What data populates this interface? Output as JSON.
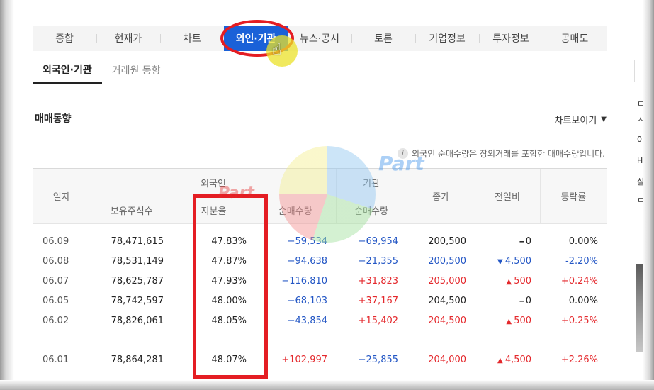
{
  "tabs": [
    "종합",
    "현재가",
    "차트",
    "외인·기관",
    "뉴스·공시",
    "토론",
    "기업정보",
    "투자정보",
    "공매도"
  ],
  "active_tab_index": 3,
  "subtabs": [
    "외국인·기관",
    "거래원 동향"
  ],
  "section_title": "매매동향",
  "chart_toggle": "차트보이기",
  "notice": "외국인 순매수량은 장외거래를 포함한 매매수량입니다.",
  "watermark_text": "Part",
  "headers": {
    "date": "일자",
    "foreign": "외국인",
    "institution": "기관",
    "holdings": "보유주식수",
    "ratio": "지분율",
    "foreign_net": "순매수량",
    "inst_net": "순매수량",
    "close": "종가",
    "change": "전일비",
    "rate": "등락률"
  },
  "rows": [
    {
      "date": "06.09",
      "holdings": "78,471,615",
      "ratio": "47.83%",
      "foreign_net": "−59,534",
      "inst_net": "−69,954",
      "close": "200,500",
      "change": "0",
      "change_dir": "flat",
      "rate": "0.00%"
    },
    {
      "date": "06.08",
      "holdings": "78,531,149",
      "ratio": "47.87%",
      "foreign_net": "−94,638",
      "inst_net": "−21,355",
      "close": "200,500",
      "change": "4,500",
      "change_dir": "down",
      "rate": "-2.20%"
    },
    {
      "date": "06.07",
      "holdings": "78,625,787",
      "ratio": "47.93%",
      "foreign_net": "−116,810",
      "inst_net": "+31,823",
      "close": "205,000",
      "change": "500",
      "change_dir": "up",
      "rate": "+0.24%"
    },
    {
      "date": "06.05",
      "holdings": "78,742,597",
      "ratio": "48.00%",
      "foreign_net": "−68,103",
      "inst_net": "+37,167",
      "close": "204,500",
      "change": "0",
      "change_dir": "flat",
      "rate": "0.00%"
    },
    {
      "date": "06.02",
      "holdings": "78,826,061",
      "ratio": "48.05%",
      "foreign_net": "−43,854",
      "inst_net": "+15,402",
      "close": "204,500",
      "change": "500",
      "change_dir": "up",
      "rate": "+0.25%"
    },
    {
      "date": "06.01",
      "holdings": "78,864,281",
      "ratio": "48.07%",
      "foreign_net": "+102,997",
      "inst_net": "−25,855",
      "close": "204,000",
      "change": "4,500",
      "change_dir": "up",
      "rate": "+2.26%"
    }
  ],
  "side_panel": [
    "ㄷ",
    "스",
    "0",
    "H",
    "실",
    "ㄷ"
  ],
  "colors": {
    "accent": "#1a61d8",
    "up": "#e4282c",
    "down": "#2457c5",
    "annotation": "#e41d23"
  }
}
